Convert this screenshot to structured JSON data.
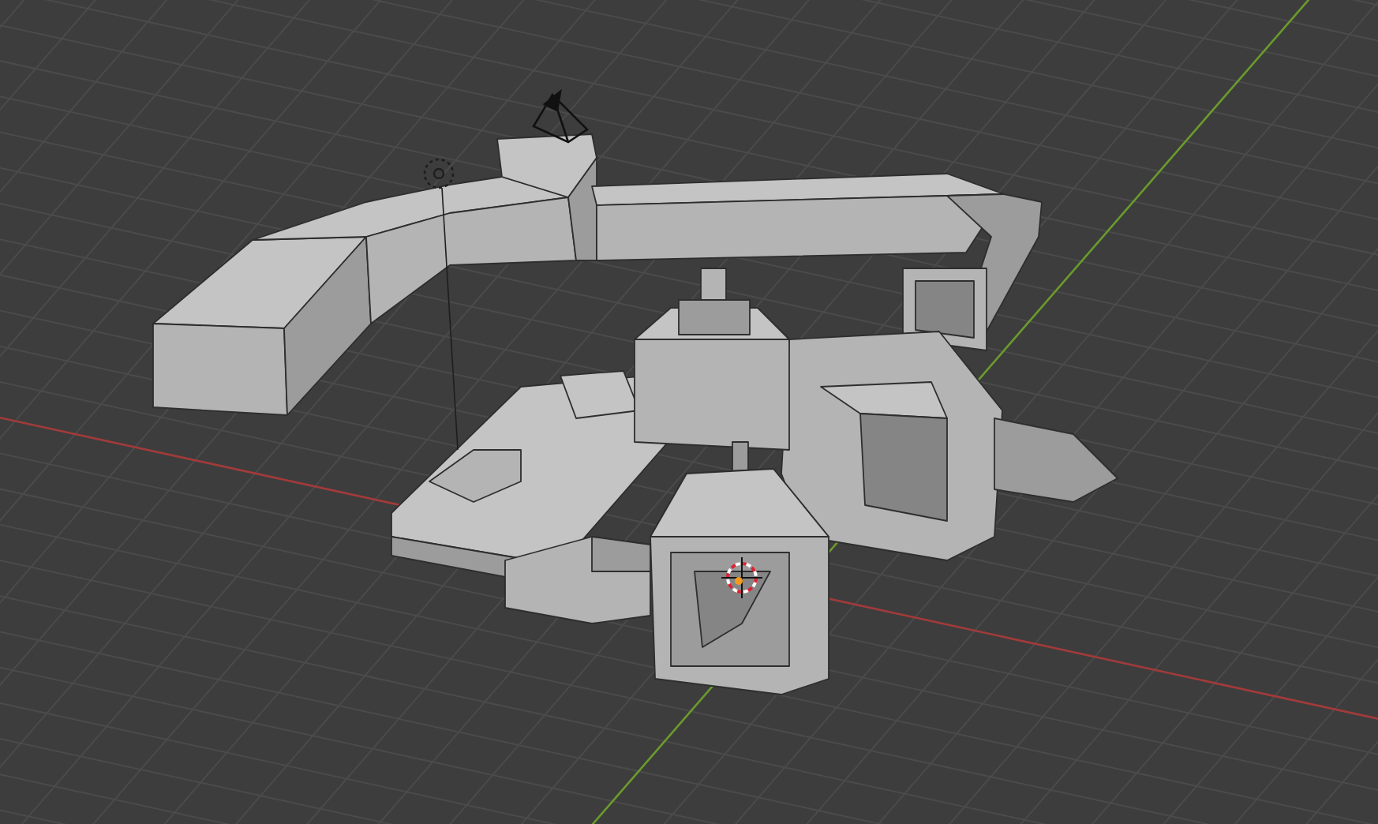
{
  "viewport": {
    "objects": [
      {
        "kind": "grid"
      },
      {
        "kind": "axes"
      },
      {
        "kind": "mesh"
      },
      {
        "kind": "light"
      },
      {
        "kind": "camera"
      },
      {
        "kind": "cursor"
      }
    ]
  }
}
